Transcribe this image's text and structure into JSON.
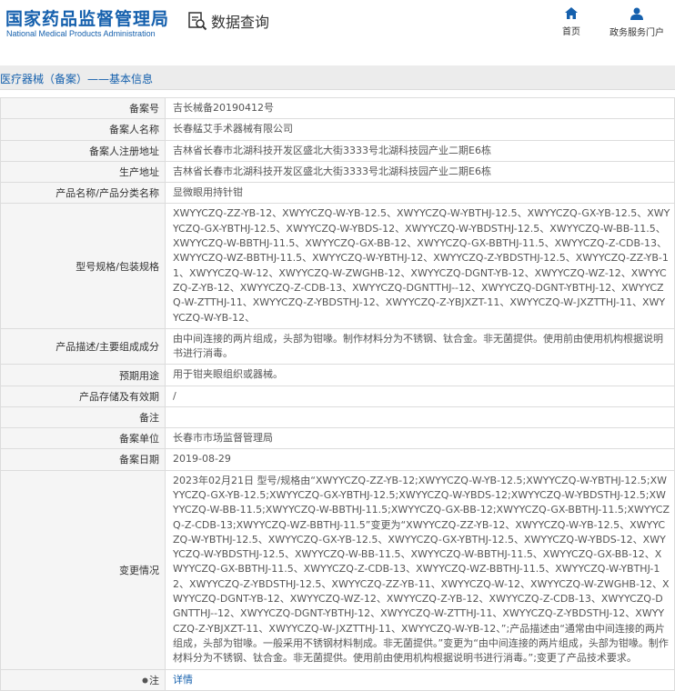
{
  "header": {
    "logo_cn": "国家药品监督管理局",
    "logo_en": "National Medical Products Administration",
    "page_name": "数据查询",
    "nav": [
      {
        "label": "首页",
        "icon": "home-icon"
      },
      {
        "label": "政务服务门户",
        "icon": "user-icon"
      }
    ]
  },
  "section": {
    "title": "医疗器械（备案）——基本信息"
  },
  "rows": [
    {
      "key": "备案号",
      "value": "吉长械备20190412号"
    },
    {
      "key": "备案人名称",
      "value": "长春艋艾手术器械有限公司"
    },
    {
      "key": "备案人注册地址",
      "value": "吉林省长春市北湖科技开发区盛北大街3333号北湖科技园产业二期E6栋"
    },
    {
      "key": "生产地址",
      "value": "吉林省长春市北湖科技开发区盛北大街3333号北湖科技园产业二期E6栋"
    },
    {
      "key": "产品名称/产品分类名称",
      "value": "显微眼用持针钳"
    },
    {
      "key": "型号规格/包装规格",
      "value": "XWYYCZQ-ZZ-YB-12、XWYYCZQ-W-YB-12.5、XWYYCZQ-W-YBTHJ-12.5、XWYYCZQ-GX-YB-12.5、XWYYCZQ-GX-YBTHJ-12.5、XWYYCZQ-W-YBDS-12、XWYYCZQ-W-YBDSTHJ-12.5、XWYYCZQ-W-BB-11.5、XWYYCZQ-W-BBTHJ-11.5、XWYYCZQ-GX-BB-12、XWYYCZQ-GX-BBTHJ-11.5、XWYYCZQ-Z-CDB-13、XWYYCZQ-WZ-BBTHJ-11.5、XWYYCZQ-W-YBTHJ-12、XWYYCZQ-Z-YBDSTHJ-12.5、XWYYCZQ-ZZ-YB-11、XWYYCZQ-W-12、XWYYCZQ-W-ZWGHB-12、XWYYCZQ-DGNT-YB-12、XWYYCZQ-WZ-12、XWYYCZQ-Z-YB-12、XWYYCZQ-Z-CDB-13、XWYYCZQ-DGNTTHJ--12、XWYYCZQ-DGNT-YBTHJ-12、XWYYCZQ-W-ZTTHJ-11、XWYYCZQ-Z-YBDSTHJ-12、XWYYCZQ-Z-YBJXZT-11、XWYYCZQ-W-JXZTTHJ-11、XWYYCZQ-W-YB-12、"
    },
    {
      "key": "产品描述/主要组成成分",
      "value": "由中间连接的两片组成，头部为钳喙。制作材料分为不锈钢、钛合金。非无菌提供。使用前由使用机构根据说明书进行消毒。"
    },
    {
      "key": "预期用途",
      "value": "用于钳夹眼组织或器械。"
    },
    {
      "key": "产品存储及有效期",
      "value": "/"
    },
    {
      "key": "备注",
      "value": ""
    },
    {
      "key": "备案单位",
      "value": "长春市市场监督管理局"
    },
    {
      "key": "备案日期",
      "value": "2019-08-29"
    },
    {
      "key": "变更情况",
      "value": "2023年02月21日 型号/规格由“XWYYCZQ-ZZ-YB-12;XWYYCZQ-W-YB-12.5;XWYYCZQ-W-YBTHJ-12.5;XWYYCZQ-GX-YB-12.5;XWYYCZQ-GX-YBTHJ-12.5;XWYYCZQ-W-YBDS-12;XWYYCZQ-W-YBDSTHJ-12.5;XWYYCZQ-W-BB-11.5;XWYYCZQ-W-BBTHJ-11.5;XWYYCZQ-GX-BB-12;XWYYCZQ-GX-BBTHJ-11.5;XWYYCZQ-Z-CDB-13;XWYYCZQ-WZ-BBTHJ-11.5”变更为“XWYYCZQ-ZZ-YB-12、XWYYCZQ-W-YB-12.5、XWYYCZQ-W-YBTHJ-12.5、XWYYCZQ-GX-YB-12.5、XWYYCZQ-GX-YBTHJ-12.5、XWYYCZQ-W-YBDS-12、XWYYCZQ-W-YBDSTHJ-12.5、XWYYCZQ-W-BB-11.5、XWYYCZQ-W-BBTHJ-11.5、XWYYCZQ-GX-BB-12、XWYYCZQ-GX-BBTHJ-11.5、XWYYCZQ-Z-CDB-13、XWYYCZQ-WZ-BBTHJ-11.5、XWYYCZQ-W-YBTHJ-12、XWYYCZQ-Z-YBDSTHJ-12.5、XWYYCZQ-ZZ-YB-11、XWYYCZQ-W-12、XWYYCZQ-W-ZWGHB-12、XWYYCZQ-DGNT-YB-12、XWYYCZQ-WZ-12、XWYYCZQ-Z-YB-12、XWYYCZQ-Z-CDB-13、XWYYCZQ-DGNTTHJ--12、XWYYCZQ-DGNT-YBTHJ-12、XWYYCZQ-W-ZTTHJ-11、XWYYCZQ-Z-YBDSTHJ-12、XWYYCZQ-Z-YBJXZT-11、XWYYCZQ-W-JXZTTHJ-11、XWYYCZQ-W-YB-12、”;产品描述由“通常由中间连接的两片组成，头部为钳喙。一般采用不锈钢材料制成。非无菌提供。”变更为“由中间连接的两片组成，头部为钳喙。制作材料分为不锈钢、钛合金。非无菌提供。使用前由使用机构根据说明书进行消毒。”;变更了产品技术要求。"
    }
  ],
  "note_row": {
    "key": "注",
    "link": "详情",
    "icon": "info-dot-icon"
  }
}
